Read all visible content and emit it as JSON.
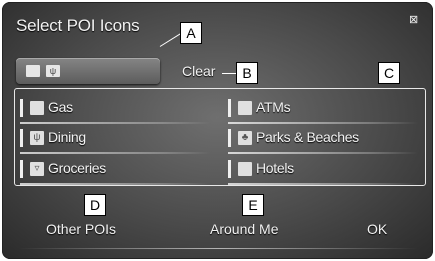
{
  "header": {
    "title": "Select POI Icons"
  },
  "selected_icons": [
    {
      "icon": "square-icon"
    },
    {
      "icon": "dining-icon"
    }
  ],
  "clear_label": "Clear",
  "poi_items": [
    {
      "label": "Gas",
      "icon": "gas-icon"
    },
    {
      "label": "ATMs",
      "icon": "atm-icon"
    },
    {
      "label": "Dining",
      "icon": "dining-icon"
    },
    {
      "label": "Parks & Beaches",
      "icon": "park-icon"
    },
    {
      "label": "Groceries",
      "icon": "groceries-icon"
    },
    {
      "label": "Hotels",
      "icon": "hotel-icon"
    }
  ],
  "footer": {
    "other_pois_label": "Other POIs",
    "around_me_label": "Around Me",
    "ok_label": "OK"
  },
  "callouts": {
    "a": "A",
    "b": "B",
    "c": "C",
    "d": "D",
    "e": "E"
  }
}
